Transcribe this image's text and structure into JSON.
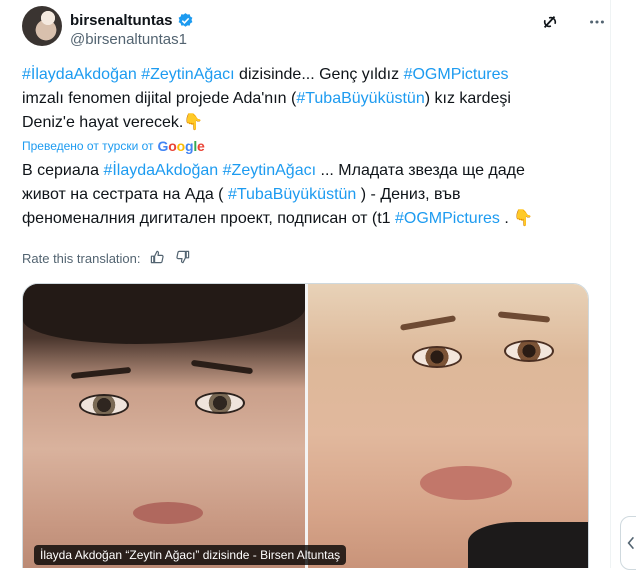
{
  "author": {
    "display_name": "birsenaltuntas",
    "handle": "@birsenaltuntas1",
    "verified": true
  },
  "tweet": {
    "lines": [
      [
        {
          "text": "#İlaydaAkdoğan",
          "tag": true
        },
        {
          "text": " ",
          "tag": false
        },
        {
          "text": "#ZeytinAğacı",
          "tag": true
        },
        {
          "text": " dizisinde... Genç yıldız ",
          "tag": false
        },
        {
          "text": "#OGMPictures",
          "tag": true
        }
      ],
      [
        {
          "text": "imzalı fenomen dijital projede Ada'nın (",
          "tag": false
        },
        {
          "text": "#TubaBüyüküstün",
          "tag": true
        },
        {
          "text": ") kız kardeşi",
          "tag": false
        }
      ],
      [
        {
          "text": "Deniz'e hayat verecek.👇",
          "tag": false
        }
      ]
    ]
  },
  "translation": {
    "label": "Преведено от турски от",
    "provider": "Google",
    "lines": [
      [
        {
          "text": "В сериала ",
          "tag": false
        },
        {
          "text": "#İlaydaAkdoğan",
          "tag": true
        },
        {
          "text": " ",
          "tag": false
        },
        {
          "text": "#ZeytinAğacı",
          "tag": true
        },
        {
          "text": " ... Младата звезда ще даде",
          "tag": false
        }
      ],
      [
        {
          "text": "живот на сестрата на Ада ( ",
          "tag": false
        },
        {
          "text": "#TubaBüyüküstün",
          "tag": true
        },
        {
          "text": " ) - Дениз, във",
          "tag": false
        }
      ],
      [
        {
          "text": "феноменалния дигитален проект, подписан от (t1 ",
          "tag": false
        },
        {
          "text": "#OGMPictures",
          "tag": true
        },
        {
          "text": " . 👇",
          "tag": false
        }
      ]
    ]
  },
  "rate": {
    "label": "Rate this translation:",
    "thumbs_up_icon": "thumbs-up-icon",
    "thumbs_down_icon": "thumbs-down-icon"
  },
  "media": {
    "caption": "İlayda Akdoğan “Zeytin Ağacı” dizisinde - Birsen Altuntaş"
  },
  "colors": {
    "accent": "#1d9bf0",
    "muted": "#536471",
    "text": "#0f1419",
    "border": "#cfd9de"
  }
}
